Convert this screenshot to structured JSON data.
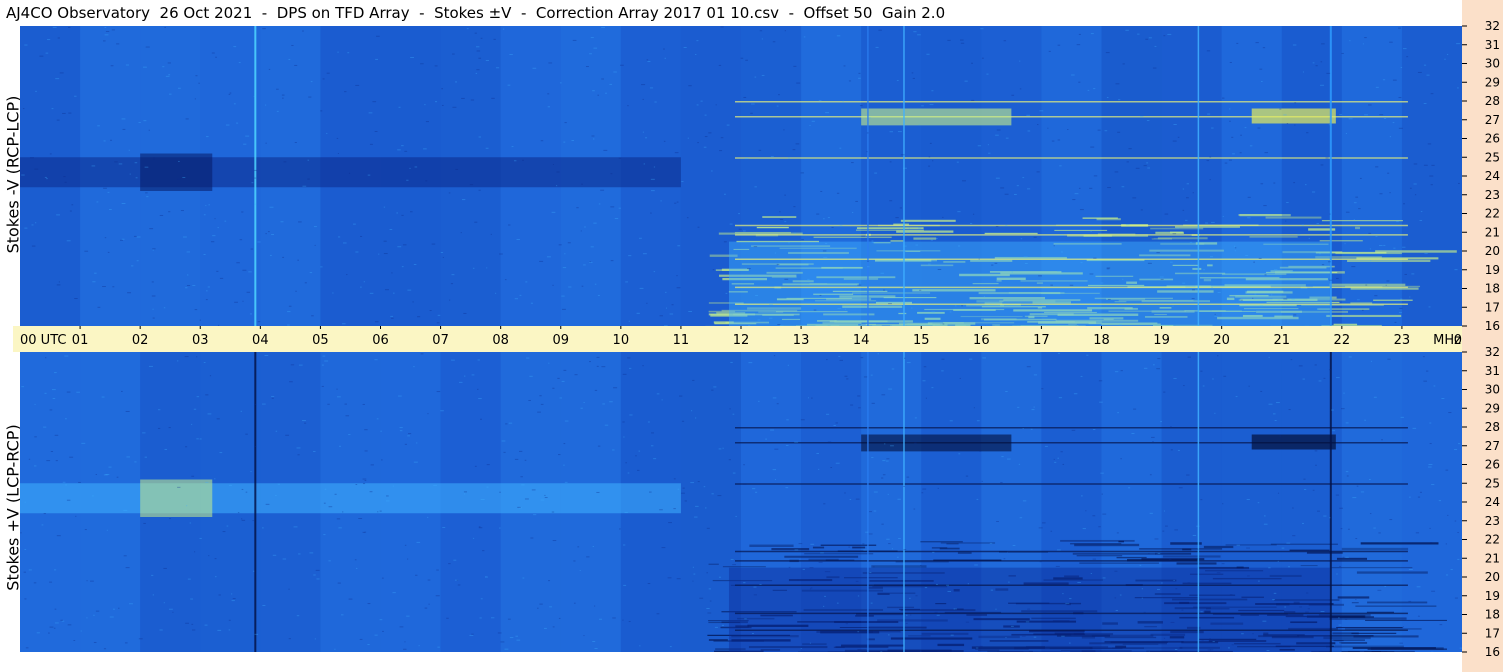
{
  "title": "AJ4CO Observatory  26 Oct 2021  -  DPS on TFD Array  -  Stokes ±V  -  Correction Array 2017 01 10.csv  -  Offset 50  Gain 2.0",
  "chart_data": [
    {
      "type": "heatmap",
      "panel": "top",
      "ylabel": "Stokes -V (RCP-LCP)",
      "x_ticks": [
        "00 UTC",
        "01",
        "02",
        "03",
        "04",
        "05",
        "06",
        "07",
        "08",
        "09",
        "10",
        "11",
        "12",
        "13",
        "14",
        "15",
        "16",
        "17",
        "18",
        "19",
        "20",
        "21",
        "22",
        "23",
        "00"
      ],
      "x_range_utc_hours": [
        0,
        24
      ],
      "y_unit": "MHz",
      "y_ticks": [
        16,
        17,
        18,
        19,
        20,
        21,
        22,
        23,
        24,
        25,
        26,
        27,
        28,
        29,
        30,
        31,
        32
      ],
      "y_range_mhz": [
        16,
        32
      ],
      "colors": {
        "background": "#1d63d8",
        "dark": "#0b2a8c",
        "light": "#3fb0ff",
        "hot": "#c8f08a"
      }
    },
    {
      "type": "heatmap",
      "panel": "bottom",
      "ylabel": "Stokes +V (LCP-RCP)",
      "x_ticks": [
        "00 UTC",
        "01",
        "02",
        "03",
        "04",
        "05",
        "06",
        "07",
        "08",
        "09",
        "10",
        "11",
        "12",
        "13",
        "14",
        "15",
        "16",
        "17",
        "18",
        "19",
        "20",
        "21",
        "22",
        "23",
        "00"
      ],
      "x_range_utc_hours": [
        0,
        24
      ],
      "y_unit": "MHz",
      "y_ticks": [
        16,
        17,
        18,
        19,
        20,
        21,
        22,
        23,
        24,
        25,
        26,
        27,
        28,
        29,
        30,
        31,
        32
      ],
      "y_range_mhz": [
        16,
        32
      ],
      "colors": {
        "background": "#1d63d8",
        "dark": "#0b2a8c",
        "light": "#3fb0ff",
        "hot": "#c8f08a"
      }
    }
  ],
  "timebar_unit": "MHz",
  "colors": {
    "timebar": "#fbf6c4",
    "freqstrip": "#fbe0c9"
  }
}
